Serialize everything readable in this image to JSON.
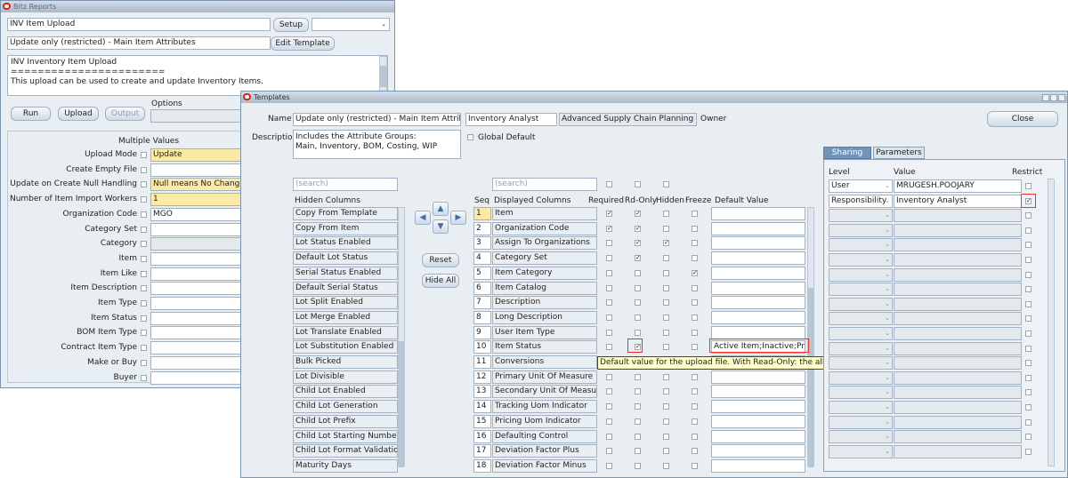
{
  "bitz": {
    "title": "Bitz Reports",
    "upload_name": "INV Item Upload",
    "setup_btn": "Setup",
    "template_name": "Update only (restricted) - Main Item Attributes",
    "edit_template_btn": "Edit Template",
    "desc_lines": [
      "INV Inventory Item Upload",
      "=======================",
      "This upload can be used to create and update Inventory Items."
    ],
    "run_btn": "Run",
    "upload_btn": "Upload",
    "output_btn": "Output",
    "options_label": "Options",
    "multiple_values_label": "Multiple Values",
    "params": [
      {
        "label": "Upload Mode",
        "value": "Update",
        "style": "yel"
      },
      {
        "label": "Create Empty File",
        "value": "",
        "style": "w"
      },
      {
        "label": "Update on Create Null Handling",
        "value": "Null means No Change",
        "style": "yel"
      },
      {
        "label": "Number of Item Import Workers",
        "value": "1",
        "style": "yel"
      },
      {
        "label": "Organization Code",
        "value": "MGO",
        "style": "w"
      },
      {
        "label": "Category Set",
        "value": "",
        "style": "w"
      },
      {
        "label": "Category",
        "value": "",
        "style": "g"
      },
      {
        "label": "Item",
        "value": "",
        "style": "w"
      },
      {
        "label": "Item Like",
        "value": "",
        "style": "w"
      },
      {
        "label": "Item Description",
        "value": "",
        "style": "w"
      },
      {
        "label": "Item Type",
        "value": "",
        "style": "w"
      },
      {
        "label": "Item Status",
        "value": "",
        "style": "w"
      },
      {
        "label": "BOM Item Type",
        "value": "",
        "style": "w"
      },
      {
        "label": "Contract Item Type",
        "value": "",
        "style": "w"
      },
      {
        "label": "Make or Buy",
        "value": "",
        "style": "w"
      },
      {
        "label": "Buyer",
        "value": "",
        "style": "w"
      }
    ]
  },
  "tpl": {
    "title": "Templates",
    "name_label": "Name",
    "name_value": "Update only (restricted) - Main Item Attributes",
    "owner_resp": "Inventory Analyst",
    "owner_app": "Advanced Supply Chain Planning",
    "owner_label": "Owner",
    "close_btn": "Close",
    "description_label": "Description",
    "description_lines": [
      "Includes the Attribute Groups:",
      "Main, Inventory, BOM, Costing, WIP"
    ],
    "global_default": "Global Default",
    "search_placeholder": "(search)",
    "hidden_header": "Hidden Columns",
    "reset_btn": "Reset",
    "hide_all_btn": "Hide All",
    "hidden_columns": [
      "Copy From Template",
      "Copy From Item",
      "Lot Status Enabled",
      "Default Lot Status",
      "Serial Status Enabled",
      "Default Serial Status",
      "Lot Split Enabled",
      "Lot Merge Enabled",
      "Lot Translate Enabled",
      "Lot Substitution Enabled",
      "Bulk Picked",
      "Lot Divisible",
      "Child Lot Enabled",
      "Child Lot Generation",
      "Child Lot Prefix",
      "Child Lot Starting Number",
      "Child Lot Format Validation",
      "Maturity Days"
    ],
    "headers": {
      "seq": "Seq",
      "displayed": "Displayed Columns",
      "required": "Required",
      "rdonly": "Rd-Only",
      "hidden": "Hidden",
      "freeze": "Freeze",
      "default": "Default Value"
    },
    "rows": [
      {
        "seq": "1",
        "name": "Item",
        "req": true,
        "ro": true,
        "hid": false,
        "frz": false,
        "def": ""
      },
      {
        "seq": "2",
        "name": "Organization Code",
        "req": true,
        "ro": true,
        "hid": false,
        "frz": false,
        "def": ""
      },
      {
        "seq": "3",
        "name": "Assign To Organizations",
        "req": false,
        "ro": true,
        "hid": true,
        "frz": false,
        "def": ""
      },
      {
        "seq": "4",
        "name": "Category Set",
        "req": false,
        "ro": true,
        "hid": false,
        "frz": false,
        "def": ""
      },
      {
        "seq": "5",
        "name": "Item Category",
        "req": false,
        "ro": false,
        "hid": false,
        "frz": true,
        "def": ""
      },
      {
        "seq": "6",
        "name": "Item Catalog",
        "req": false,
        "ro": false,
        "hid": false,
        "frz": false,
        "def": ""
      },
      {
        "seq": "7",
        "name": "Description",
        "req": false,
        "ro": false,
        "hid": false,
        "frz": false,
        "def": ""
      },
      {
        "seq": "8",
        "name": "Long Description",
        "req": false,
        "ro": false,
        "hid": false,
        "frz": false,
        "def": ""
      },
      {
        "seq": "9",
        "name": "User Item Type",
        "req": false,
        "ro": false,
        "hid": false,
        "frz": false,
        "def": ""
      },
      {
        "seq": "10",
        "name": "Item Status",
        "req": false,
        "ro": true,
        "hid": false,
        "frz": false,
        "def": "Active Item;Inactive;Proto"
      },
      {
        "seq": "11",
        "name": "Conversions",
        "req": false,
        "ro": false,
        "hid": false,
        "frz": false,
        "def": ""
      },
      {
        "seq": "12",
        "name": "Primary Unit Of Measure",
        "req": false,
        "ro": false,
        "hid": false,
        "frz": false,
        "def": ""
      },
      {
        "seq": "13",
        "name": "Secondary Unit Of Measure",
        "req": false,
        "ro": false,
        "hid": false,
        "frz": false,
        "def": ""
      },
      {
        "seq": "14",
        "name": "Tracking Uom Indicator",
        "req": false,
        "ro": false,
        "hid": false,
        "frz": false,
        "def": ""
      },
      {
        "seq": "15",
        "name": "Pricing Uom Indicator",
        "req": false,
        "ro": false,
        "hid": false,
        "frz": false,
        "def": ""
      },
      {
        "seq": "16",
        "name": "Defaulting Control",
        "req": false,
        "ro": false,
        "hid": false,
        "frz": false,
        "def": ""
      },
      {
        "seq": "17",
        "name": "Deviation Factor Plus",
        "req": false,
        "ro": false,
        "hid": false,
        "frz": false,
        "def": ""
      },
      {
        "seq": "18",
        "name": "Deviation Factor Minus",
        "req": false,
        "ro": false,
        "hid": false,
        "frz": false,
        "def": ""
      }
    ],
    "tooltip": "Default value for the upload file. With Read-Only: the allowed value(s), semicolon separated",
    "tabs": {
      "sharing": "Sharing",
      "parameters": "Parameters"
    },
    "share_headers": {
      "level": "Level",
      "value": "Value",
      "restrict": "Restrict"
    },
    "sharing_rows": [
      {
        "level": "User",
        "value": "MRUGESH.POOJARY",
        "restrict": false
      },
      {
        "level": "Responsibility",
        "value": "Inventory Analyst",
        "restrict": true
      }
    ]
  }
}
